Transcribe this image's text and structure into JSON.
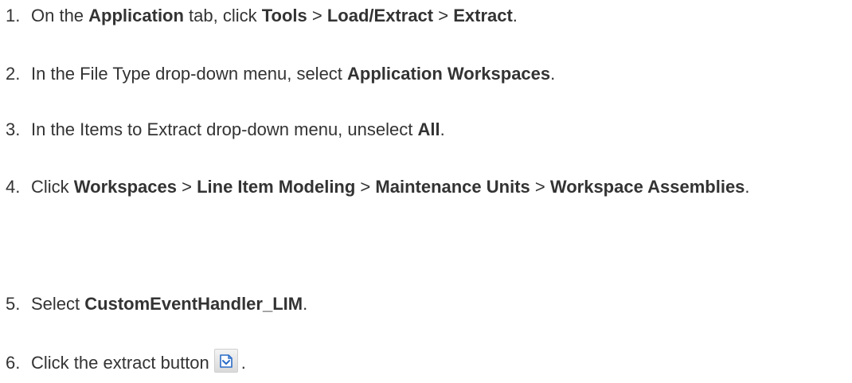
{
  "steps": [
    {
      "number": "1.",
      "parts": [
        "On the ",
        "Application",
        " tab, click ",
        "Tools",
        " > ",
        "Load/Extract",
        " > ",
        "Extract",
        "."
      ]
    },
    {
      "number": "2.",
      "parts": [
        "In the File Type drop-down menu, select ",
        "Application Workspaces",
        "."
      ]
    },
    {
      "number": "3.",
      "parts": [
        "In the Items to Extract drop-down menu, unselect ",
        "All",
        "."
      ]
    },
    {
      "number": "4.",
      "parts": [
        "Click ",
        "Workspaces",
        " > ",
        "Line Item Modeling",
        " > ",
        "Maintenance Units",
        " > ",
        "Workspace Assemblies",
        "."
      ]
    },
    {
      "number": "5.",
      "parts": [
        "Select ",
        "CustomEventHandler_LIM",
        "."
      ]
    },
    {
      "number": "6.",
      "parts": [
        "Click the extract button",
        "."
      ]
    }
  ],
  "icons": {
    "extract_button": "extract-icon"
  },
  "colors": {
    "text": "#333333",
    "icon_blue": "#2a6cc8"
  }
}
